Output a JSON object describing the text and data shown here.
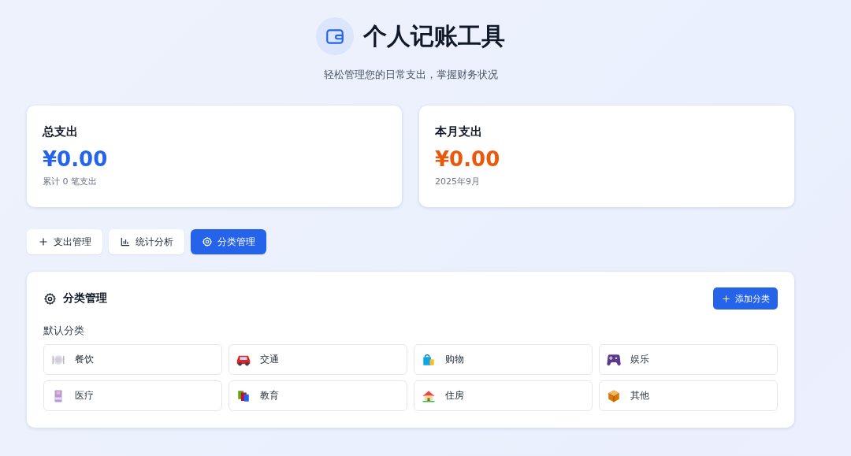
{
  "header": {
    "title": "个人记账工具",
    "subtitle": "轻松管理您的日常支出，掌握财务状况"
  },
  "summary_cards": [
    {
      "label": "总支出",
      "amount": "¥0.00",
      "note": "累计 0 笔支出",
      "color": "#2563eb"
    },
    {
      "label": "本月支出",
      "amount": "¥0.00",
      "note": "2025年9月",
      "color": "#ea580c"
    }
  ],
  "tabs": [
    {
      "label": "支出管理",
      "selected": false
    },
    {
      "label": "统计分析",
      "selected": false
    },
    {
      "label": "分类管理",
      "selected": true
    }
  ],
  "panel": {
    "title": "分类管理",
    "add_button": "添加分类",
    "section_label": "默认分类",
    "categories": [
      {
        "name": "餐饮"
      },
      {
        "name": "交通"
      },
      {
        "name": "购物"
      },
      {
        "name": "娱乐"
      },
      {
        "name": "医疗"
      },
      {
        "name": "教育"
      },
      {
        "name": "住房"
      },
      {
        "name": "其他"
      }
    ]
  }
}
